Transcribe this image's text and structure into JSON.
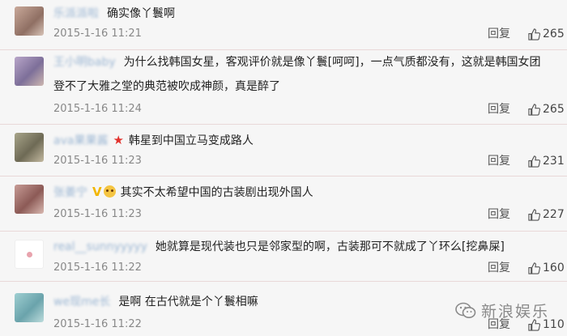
{
  "comments": [
    {
      "username": "乐派派啦",
      "text": "确实像丫鬟啊",
      "time": "2015-1-16 11:21",
      "reply": "回复",
      "likes": "265"
    },
    {
      "username": "王小明baby",
      "text": "为什么找韩国女星，客观评价就是像丫鬟[呵呵]，一点气质都没有，这就是韩国女团",
      "text2": "登不了大雅之堂的典范被吹成神颜，真是醉了",
      "time": "2015-1-16 11:24",
      "reply": "回复",
      "likes": "265"
    },
    {
      "username": "ava果果酱",
      "text": "韩星到中国立马变成路人",
      "time": "2015-1-16 11:23",
      "reply": "回复",
      "likes": "231"
    },
    {
      "username": "张姜宁",
      "text": "其实不太希望中国的古装剧出现外国人",
      "time": "2015-1-16 11:23",
      "reply": "回复",
      "likes": "227"
    },
    {
      "username": "real__sunnyyyyy",
      "text": "她就算是现代装也只是邻家型的啊，古装那可不就成了丫环么[挖鼻屎]",
      "time": "2015-1-16 11:22",
      "reply": "回复",
      "likes": "160"
    },
    {
      "username": "we现me长",
      "text": "是啊 在古代就是个丫鬟相嘛",
      "time": "2015-1-16 11:22",
      "reply": "回复",
      "likes": "110"
    }
  ],
  "watermark": "新浪娱乐",
  "colors": {
    "background": "#f6f6f6",
    "username": "#9bb6d3",
    "time": "#888888",
    "separator": "#e9d8d8",
    "star": "#e2322d"
  }
}
